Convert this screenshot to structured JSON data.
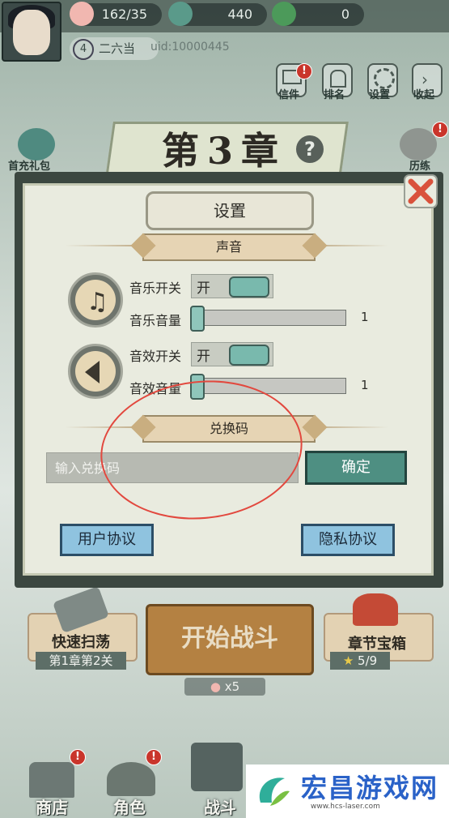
{
  "topbar": {
    "resources": [
      {
        "name": "stamina",
        "value": "162/35"
      },
      {
        "name": "gems",
        "value": "440"
      },
      {
        "name": "coins",
        "value": "0"
      }
    ],
    "level": "4",
    "player_name": "二六当",
    "uid": "uid:10000445"
  },
  "top_buttons": [
    {
      "label": "信件",
      "badge": "!"
    },
    {
      "label": "排名",
      "badge": ""
    },
    {
      "label": "设置",
      "badge": ""
    },
    {
      "label": "收起",
      "badge": ""
    }
  ],
  "side_left_label": "首充礼包",
  "side_right_label": "历练",
  "chapter_title": "第3章",
  "help_icon": "?",
  "dialog": {
    "title": "设置",
    "sound_section": "声音",
    "music_toggle_label": "音乐开关",
    "music_toggle_state": "开",
    "music_volume_label": "音乐音量",
    "music_volume_value": "1",
    "sfx_toggle_label": "音效开关",
    "sfx_toggle_state": "开",
    "sfx_volume_label": "音效音量",
    "sfx_volume_value": "1",
    "redeem_section": "兑换码",
    "redeem_placeholder": "输入兑换码",
    "confirm_button": "确定",
    "user_agreement_button": "用户协议",
    "privacy_button": "隐私协议"
  },
  "bottom": {
    "sweep_label": "快速扫荡",
    "sweep_sub": "第1章第2关",
    "start_label": "开始战斗",
    "chest_label": "章节宝箱",
    "chest_progress": "5/9",
    "stamina_cost": "x5"
  },
  "nav": [
    {
      "label": "商店",
      "badge": "!"
    },
    {
      "label": "角色",
      "badge": "!"
    },
    {
      "label": "战斗",
      "badge": ""
    }
  ],
  "watermark": {
    "title": "宏昌游戏网",
    "url": "www.hcs-laser.com"
  },
  "colors": {
    "accent_teal": "#4e8f82",
    "badge_red": "#c9352b",
    "annotation_red": "#e2483e",
    "button_blue": "#8fc3df"
  }
}
